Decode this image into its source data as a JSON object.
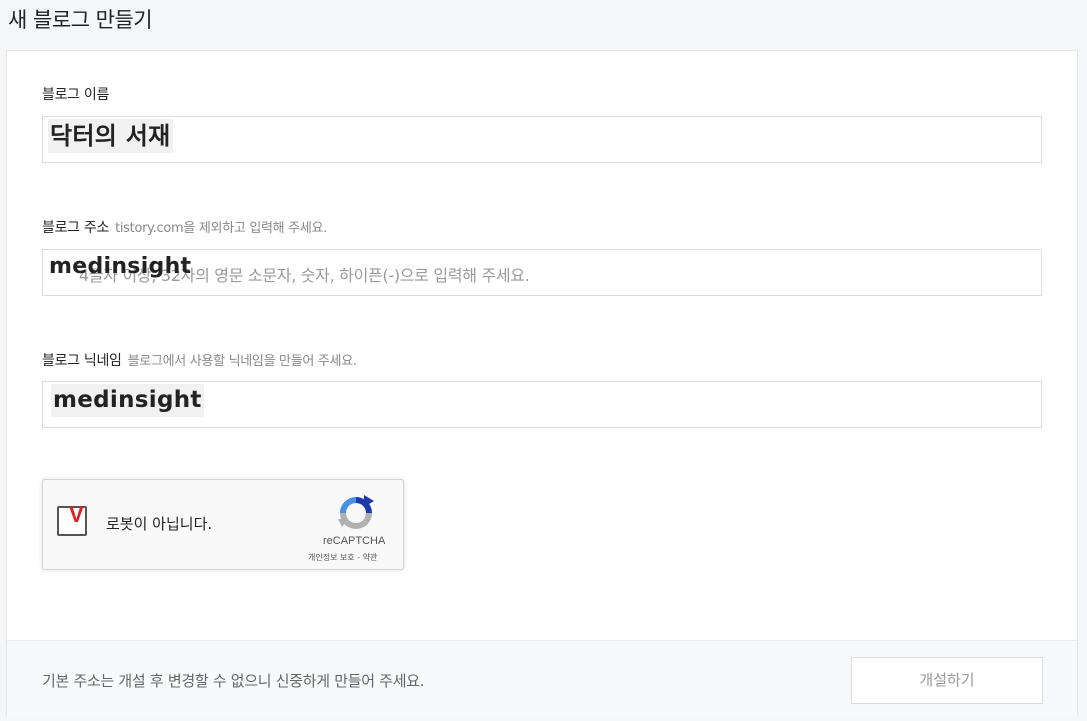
{
  "page": {
    "title": "새 블로그 만들기"
  },
  "blog_name": {
    "label": "블로그 이름",
    "value": "닥터의 서재"
  },
  "blog_address": {
    "label": "블로그 주소",
    "hint": "tistory.com을 제외하고 입력해 주세요.",
    "placeholder": "4글자 이상, 32자의 영문 소문자, 숫자, 하이픈(-)으로 입력해 주세요.",
    "value": "medinsight"
  },
  "blog_nickname": {
    "label": "블로그 닉네임",
    "hint": "블로그에서 사용할 닉네임을 만들어 주세요.",
    "value": "medinsight"
  },
  "recaptcha": {
    "label": "로봇이 아닙니다.",
    "check_glyph": "V",
    "brand": "reCAPTCHA",
    "terms": "개인정보 보호 - 약관"
  },
  "footer": {
    "note": "기본 주소는 개설 후 변경할 수 없으니 신중하게 만들어 주세요.",
    "submit_label": "개설하기"
  },
  "colors": {
    "check_mark": "#e02020",
    "recaptcha_blue": "#1c3aa9",
    "recaptcha_lightblue": "#4a90e2",
    "recaptcha_gray": "#b0b0b0"
  }
}
